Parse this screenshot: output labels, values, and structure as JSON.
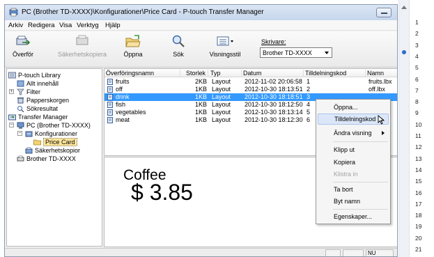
{
  "window": {
    "title": "PC (Brother TD-XXXX)\\Konfigurationer\\Price Card - P-touch Transfer Manager"
  },
  "menu": [
    "Arkiv",
    "Redigera",
    "Visa",
    "Verktyg",
    "Hjälp"
  ],
  "toolbar": {
    "transfer_label": "Överför",
    "backup_label": "Säkerhetskopiera",
    "open_label": "Öppna",
    "search_label": "Sök",
    "view_style_label": "Visningsstil",
    "printer_label": "Skrivare:",
    "printer_value": "Brother TD-XXXX"
  },
  "tree": [
    "P-touch Library",
    "Allt innehåll",
    "Filter",
    "Papperskorgen",
    "Sökresultat",
    "Transfer Manager",
    "PC (Brother TD-XXXX)",
    "Konfigurationer",
    "Price Card",
    "Säkerhetskopior",
    "Brother TD-XXXX"
  ],
  "table": {
    "columns": [
      "Överföringsnamn",
      "Storlek",
      "Typ",
      "Datum",
      "Tilldelningskod",
      "Namn"
    ],
    "rows": [
      [
        "fruits",
        "2KB",
        "Layout",
        "2012-11-02 20:06:58",
        "1",
        "fruits.lbx"
      ],
      [
        "off",
        "1KB",
        "Layout",
        "2012-10-30 18:13:51",
        "2",
        "off.lbx"
      ],
      [
        "drink",
        "1KB",
        "Layout",
        "2012-10-30 18:18:51",
        "3",
        ""
      ],
      [
        "fish",
        "1KB",
        "Layout",
        "2012-10-30 18:12:50",
        "4",
        ""
      ],
      [
        "vegetables",
        "1KB",
        "Layout",
        "2012-10-30 18:13:14",
        "5",
        ""
      ],
      [
        "meat",
        "1KB",
        "Layout",
        "2012-10-30 18:12:30",
        "6",
        ""
      ]
    ],
    "selected_row": 2
  },
  "preview": {
    "title": "Coffee",
    "price": "$ 3.85"
  },
  "context_menu": {
    "items": [
      "Öppna...",
      "Tilldelningskod",
      "Ändra visning",
      "Klipp ut",
      "Kopiera",
      "Klistra in",
      "Ta bort",
      "Byt namn",
      "Egenskaper..."
    ]
  },
  "status": {
    "num": "NU"
  },
  "line_numbers": [
    "1",
    "2",
    "3",
    "4",
    "5",
    "6",
    "7",
    "8",
    "9",
    "10",
    "11",
    "12",
    "13",
    "14",
    "15",
    "16",
    "17",
    "18",
    "19",
    "20",
    "21"
  ],
  "colors": {
    "selection": "#3399ff",
    "menu_highlight": "#dbe7f8",
    "tree_selected": "#ffe79c",
    "page_dot": "#2f6bd1"
  }
}
